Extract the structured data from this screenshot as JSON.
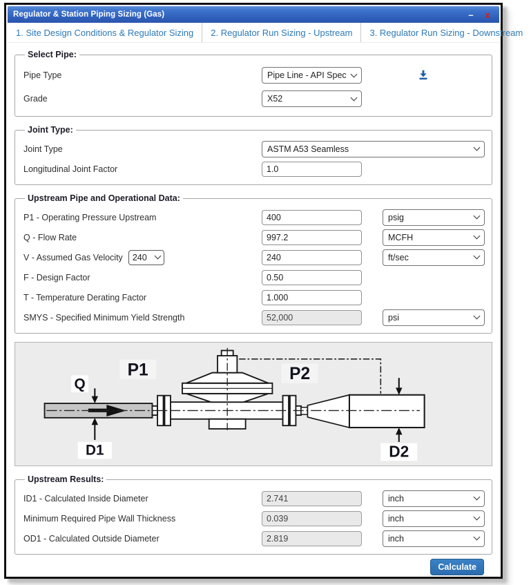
{
  "window": {
    "title": "Regulator & Station Piping Sizing (Gas)",
    "minimize_label": "–",
    "close_label": "x"
  },
  "tabs": [
    {
      "label": "1. Site Design Conditions & Regulator Sizing"
    },
    {
      "label": "2. Regulator Run Sizing - Upstream"
    },
    {
      "label": "3. Regulator Run Sizing - Downstream"
    }
  ],
  "select_pipe": {
    "legend": "Select Pipe:",
    "rows": [
      {
        "label": "Pipe Type",
        "value": "Pipe Line - API Specifi"
      },
      {
        "label": "Grade",
        "value": "X52"
      }
    ]
  },
  "joint_type": {
    "legend": "Joint Type:",
    "joint_row": {
      "label": "Joint Type",
      "value": "ASTM A53 Seamless"
    },
    "factor_row": {
      "label": "Longitudinal Joint Factor",
      "value": "1.0"
    }
  },
  "upstream_data": {
    "legend": "Upstream Pipe and Operational Data:",
    "rows": [
      {
        "label": "P1 - Operating Pressure Upstream",
        "value": "400",
        "unit": "psig"
      },
      {
        "label": "Q - Flow Rate",
        "value": "997.2",
        "unit": "MCFH"
      },
      {
        "label": "V - Assumed Gas Velocity",
        "velocity_select": "240",
        "value": "240",
        "unit": "ft/sec"
      },
      {
        "label": "F - Design Factor",
        "value": "0.50"
      },
      {
        "label": "T - Temperature Derating Factor",
        "value": "1.000"
      },
      {
        "label": "SMYS - Specified Minimum Yield Strength",
        "value": "52,000",
        "unit": "psi"
      }
    ]
  },
  "diagram": {
    "labels": {
      "q": "Q",
      "d1": "D1",
      "p1": "P1",
      "p2": "P2",
      "d2": "D2"
    }
  },
  "upstream_results": {
    "legend": "Upstream Results:",
    "rows": [
      {
        "label": "ID1 - Calculated Inside Diameter",
        "value": "2.741",
        "unit": "inch"
      },
      {
        "label": "Minimum Required Pipe Wall Thickness",
        "value": "0.039",
        "unit": "inch"
      },
      {
        "label": "OD1 - Calculated Outside Diameter",
        "value": "2.819",
        "unit": "inch"
      }
    ]
  },
  "actions": {
    "calculate_label": "Calculate"
  },
  "colors": {
    "titlebar_top": "#5b8fd9",
    "titlebar_bottom": "#2b55ae",
    "tab_text": "#2e79b5",
    "button_blue": "#2e74b5",
    "close_red": "#cf1d1d",
    "icon_blue": "#1f5fa9",
    "diagram_bg": "#ececec",
    "pipe_gray": "#c6c6c6"
  }
}
